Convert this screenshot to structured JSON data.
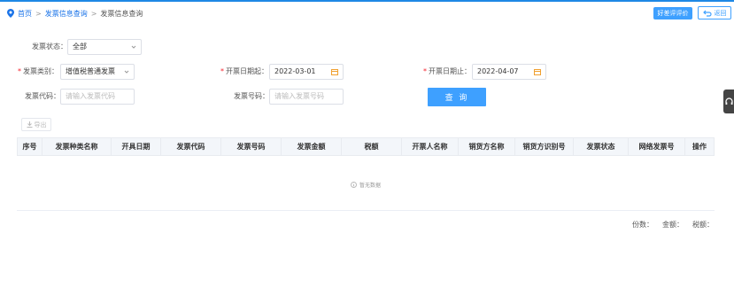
{
  "breadcrumb": {
    "home": "首页",
    "level1": "发票信息查询",
    "level2": "发票信息查询",
    "separator": ">"
  },
  "header_buttons": {
    "rate": "好差评评价",
    "back": "返回"
  },
  "filters": {
    "status_label": "发票状态：",
    "status_value": "全部",
    "type_label": "发票类别：",
    "type_value": "增值税普通发票",
    "start_label": "开票日期起：",
    "start_value": "2022-03-01",
    "end_label": "开票日期止：",
    "end_value": "2022-04-07",
    "code_label": "发票代码：",
    "code_placeholder": "请输入发票代码",
    "number_label": "发票号码：",
    "number_placeholder": "请输入发票号码",
    "required_mark": "*"
  },
  "actions": {
    "query": "查 询",
    "export": "导出"
  },
  "table": {
    "columns": [
      "序号",
      "发票种类名称",
      "开具日期",
      "发票代码",
      "发票号码",
      "发票金额",
      "税额",
      "开票人名称",
      "销货方名称",
      "销货方识别号",
      "发票状态",
      "网络发票号",
      "操作"
    ],
    "empty_text": "暂无数据"
  },
  "summary": {
    "count": "份数：",
    "amount": "金额：",
    "tax": "税额："
  },
  "colors": {
    "accent": "#3ea0ff",
    "link": "#1a73e8",
    "required": "#f5222d",
    "header_bg": "#f3f6fa"
  },
  "icons": {
    "location": "location-pin-icon",
    "chevron": "chevron-down-icon",
    "calendar": "calendar-icon",
    "back": "back-arrow-icon",
    "export": "download-icon",
    "empty": "info-circle-icon",
    "side": "headset-icon"
  }
}
